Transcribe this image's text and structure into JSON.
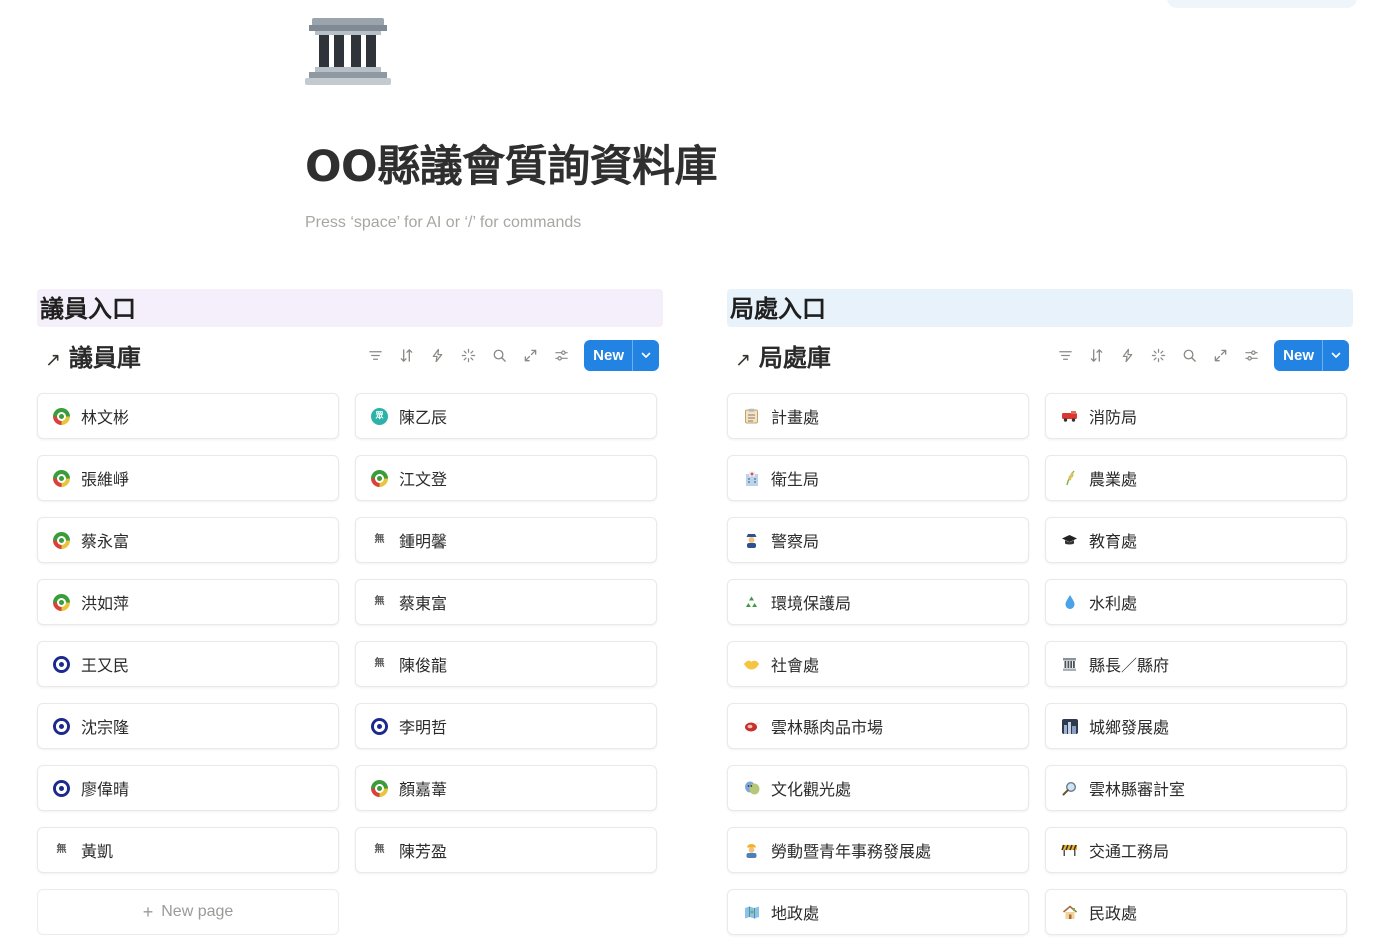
{
  "page": {
    "title": "OO縣議會質詢資料庫",
    "placeholder": "Press ‘space’ for AI or ‘/’ for commands",
    "icon": "classical-building-icon"
  },
  "sections": [
    {
      "heading": "議員入口",
      "heading_color": "#f4effa",
      "database": {
        "title": "議員庫",
        "new_label": "New",
        "new_page_label": "New page",
        "items": [
          {
            "label": "林文彬",
            "icon": "dpp-party-icon"
          },
          {
            "label": "陳乙辰",
            "icon": "tpp-party-icon"
          },
          {
            "label": "張維崢",
            "icon": "dpp-party-icon"
          },
          {
            "label": "江文登",
            "icon": "dpp-party-icon"
          },
          {
            "label": "蔡永富",
            "icon": "dpp-party-icon"
          },
          {
            "label": "鍾明馨",
            "icon": "independent-icon"
          },
          {
            "label": "洪如萍",
            "icon": "dpp-party-icon"
          },
          {
            "label": "蔡東富",
            "icon": "independent-icon"
          },
          {
            "label": "王又民",
            "icon": "kmt-party-icon"
          },
          {
            "label": "陳俊龍",
            "icon": "independent-icon"
          },
          {
            "label": "沈宗隆",
            "icon": "kmt-party-icon"
          },
          {
            "label": "李明哲",
            "icon": "kmt-party-icon"
          },
          {
            "label": "廖偉晴",
            "icon": "kmt-party-icon"
          },
          {
            "label": "顏嘉葦",
            "icon": "dpp-party-icon"
          },
          {
            "label": "黃凱",
            "icon": "independent-icon"
          },
          {
            "label": "陳芳盈",
            "icon": "independent-icon"
          }
        ]
      }
    },
    {
      "heading": "局處入口",
      "heading_color": "#e7f2fb",
      "database": {
        "title": "局處庫",
        "new_label": "New",
        "items": [
          {
            "label": "計畫處",
            "icon": "clipboard-icon"
          },
          {
            "label": "消防局",
            "icon": "fire-engine-icon"
          },
          {
            "label": "衛生局",
            "icon": "hospital-icon"
          },
          {
            "label": "農業處",
            "icon": "rice-plant-icon"
          },
          {
            "label": "警察局",
            "icon": "police-officer-icon"
          },
          {
            "label": "教育處",
            "icon": "graduation-cap-icon"
          },
          {
            "label": "環境保護局",
            "icon": "recycle-icon"
          },
          {
            "label": "水利處",
            "icon": "droplet-icon"
          },
          {
            "label": "社會處",
            "icon": "handshake-icon"
          },
          {
            "label": "縣長／縣府",
            "icon": "classical-building-icon"
          },
          {
            "label": "雲林縣肉品市場",
            "icon": "meat-icon"
          },
          {
            "label": "城鄉發展處",
            "icon": "cityscape-icon"
          },
          {
            "label": "文化觀光處",
            "icon": "performing-arts-icon"
          },
          {
            "label": "雲林縣審計室",
            "icon": "magnifier-icon"
          },
          {
            "label": "勞動暨青年事務發展處",
            "icon": "worker-icon"
          },
          {
            "label": "交通工務局",
            "icon": "construction-barrier-icon"
          },
          {
            "label": "地政處",
            "icon": "map-icon"
          },
          {
            "label": "民政處",
            "icon": "house-icon"
          }
        ]
      }
    }
  ],
  "toolbar_icons": [
    "filter-icon",
    "sort-icon",
    "automation-bolt-icon",
    "ai-sparkle-icon",
    "search-icon",
    "expand-icon",
    "settings-sliders-icon"
  ]
}
